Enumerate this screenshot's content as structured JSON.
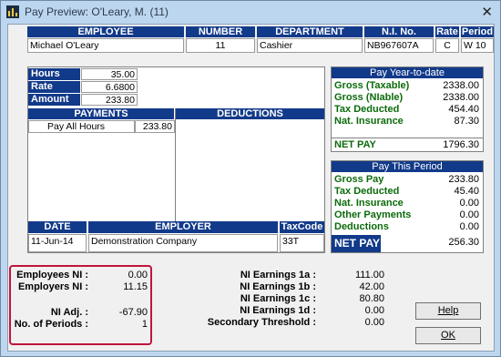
{
  "window": {
    "title": "Pay Preview: O'Leary, M.  (11)",
    "close_glyph": "✕",
    "icon": "app-chart-icon"
  },
  "employee_header": {
    "columns": [
      "EMPLOYEE",
      "NUMBER",
      "DEPARTMENT",
      "N.I. No.",
      "Rate",
      "Period"
    ],
    "values": [
      "Michael O'Leary",
      "11",
      "Cashier",
      "NB967607A",
      "C",
      "W 10"
    ]
  },
  "hours": {
    "rows": [
      {
        "label": "Hours",
        "value": "35.00"
      },
      {
        "label": "Rate",
        "value": "6.6800"
      },
      {
        "label": "Amount",
        "value": "233.80"
      }
    ]
  },
  "payments": {
    "header": "PAYMENTS",
    "items": [
      {
        "name": "Pay All Hours",
        "amount": "233.80"
      }
    ]
  },
  "deductions": {
    "header": "DEDUCTIONS"
  },
  "footer_row": {
    "columns": [
      "DATE",
      "EMPLOYER",
      "TaxCode"
    ],
    "values": [
      "11-Jun-14",
      "Demonstration Company",
      "33T"
    ]
  },
  "ytd": {
    "header": "Pay Year-to-date",
    "rows": [
      {
        "label": "Gross (Taxable)",
        "value": "2338.00"
      },
      {
        "label": "Gross (NIable)",
        "value": "2338.00"
      },
      {
        "label": "Tax Deducted",
        "value": "454.40"
      },
      {
        "label": "Nat. Insurance",
        "value": "87.30"
      }
    ],
    "net_label": "NET PAY",
    "net_value": "1796.30"
  },
  "period": {
    "header": "Pay This Period",
    "rows": [
      {
        "label": "Gross Pay",
        "value": "233.80"
      },
      {
        "label": "Tax Deducted",
        "value": "45.40"
      },
      {
        "label": "Nat. Insurance",
        "value": "0.00"
      },
      {
        "label": "Other Payments",
        "value": "0.00"
      },
      {
        "label": "Deductions",
        "value": "0.00"
      }
    ],
    "net_label": "NET PAY",
    "net_value": "256.30"
  },
  "ni_left": [
    {
      "label": "Employees NI :",
      "value": "0.00"
    },
    {
      "label": "Employers NI :",
      "value": "11.15"
    },
    {
      "label": "NI Adj. :",
      "value": "-67.90"
    },
    {
      "label": "No. of Periods :",
      "value": "1"
    }
  ],
  "ni_right": [
    {
      "label": "NI Earnings 1a :",
      "value": "111.00"
    },
    {
      "label": "NI Earnings 1b :",
      "value": "42.00"
    },
    {
      "label": "NI Earnings 1c :",
      "value": "80.80"
    },
    {
      "label": "NI Earnings 1d :",
      "value": "0.00"
    },
    {
      "label": "Secondary Threshold :",
      "value": "0.00"
    }
  ],
  "buttons": {
    "help": "Help",
    "ok": "OK"
  }
}
